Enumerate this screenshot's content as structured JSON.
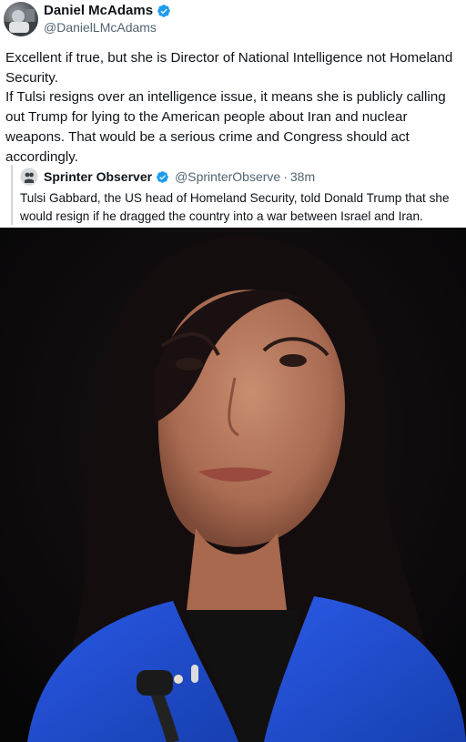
{
  "author": {
    "name": "Daniel McAdams",
    "handle": "@DanielLMcAdams",
    "verified": true,
    "verified_color": "#1d9bf0"
  },
  "post": {
    "text": "Excellent if true, but she is Director of National Intelligence not Homeland Security.\nIf Tulsi resigns over an intelligence issue, it means she is publicly calling out Trump for lying to the American people about Iran and nuclear weapons. That would be a serious crime and Congress should act accordingly."
  },
  "quote": {
    "name": "Sprinter Observer",
    "handle": "@SprinterObserve",
    "dot": "·",
    "time": "38m",
    "verified": true,
    "text": "Tulsi Gabbard, the US head of Homeland Security, told Donald Trump that she would resign if he dragged the country into a war between Israel and Iran."
  },
  "colors": {
    "text_primary": "#0f1419",
    "text_secondary": "#536471",
    "quote_border": "#cfd9de",
    "jacket_blue": "#1f4fd1",
    "photo_background": "#0b0a0c"
  },
  "icons": {
    "verified": "verified-badge-icon"
  }
}
